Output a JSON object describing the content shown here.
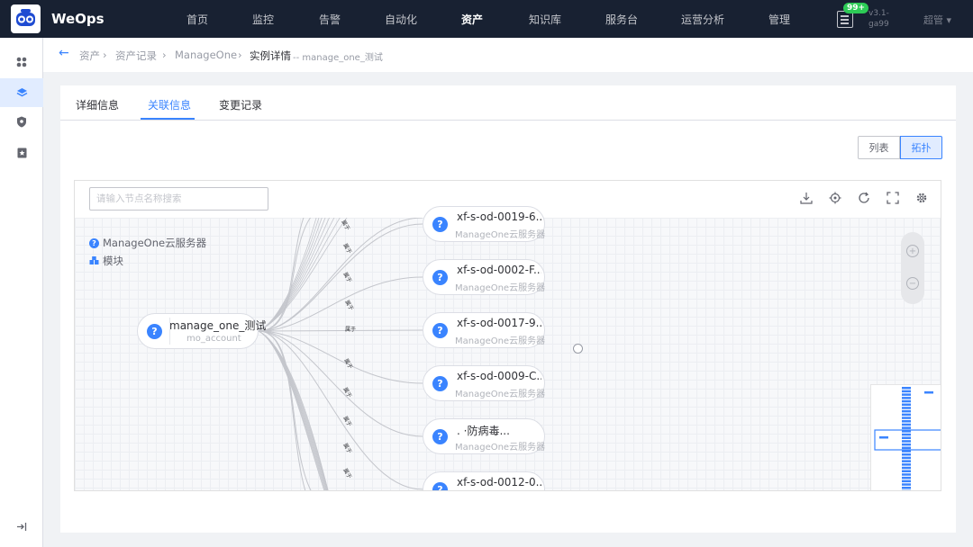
{
  "app": {
    "name": "WeOps",
    "version_line1": "v3.1-",
    "version_line2": "ga99",
    "user": "超管",
    "notification_count": "99+"
  },
  "nav": [
    "首页",
    "监控",
    "告警",
    "自动化",
    "资产",
    "知识库",
    "服务台",
    "运营分析",
    "管理"
  ],
  "nav_active": "资产",
  "breadcrumb": [
    "资产",
    "资产记录",
    "ManageOne",
    "实例详情",
    "-- manage_one_测试"
  ],
  "tabs": [
    "详细信息",
    "关联信息",
    "变更记录"
  ],
  "active_tab": "关联信息",
  "view_toggle": [
    "列表",
    "拓扑"
  ],
  "active_view": "拓扑",
  "search_placeholder": "请输入节点名称搜索",
  "legend": [
    "ManageOne云服务器",
    "模块"
  ],
  "center_node": {
    "name": "manage_one_测试",
    "type": "mo_account"
  },
  "edge_label": "属于",
  "child_nodes": [
    {
      "name": "xf-s-od-0019-6...",
      "type": "ManageOne云服务器"
    },
    {
      "name": "xf-s-od-0002-F...",
      "type": "ManageOne云服务器"
    },
    {
      "name": "xf-s-od-0017-9...",
      "type": "ManageOne云服务器"
    },
    {
      "name": "xf-s-od-0009-C...",
      "type": "ManageOne云服务器"
    },
    {
      "name": ".                    ·防病毒...",
      "type": "ManageOne云服务器"
    },
    {
      "name": "xf-s-od-0012-0...",
      "type": "ManageOne云服务器"
    }
  ],
  "colors": {
    "topbar": "#182132",
    "accent": "#3a84ff",
    "badge": "#2dcb56"
  },
  "icons": {
    "logo": "robot-logo-icon",
    "notes": "notes-icon",
    "download": "download-icon",
    "locate": "locate-icon",
    "refresh": "refresh-icon",
    "fullscreen": "fullscreen-icon",
    "settings": "gear-icon"
  }
}
